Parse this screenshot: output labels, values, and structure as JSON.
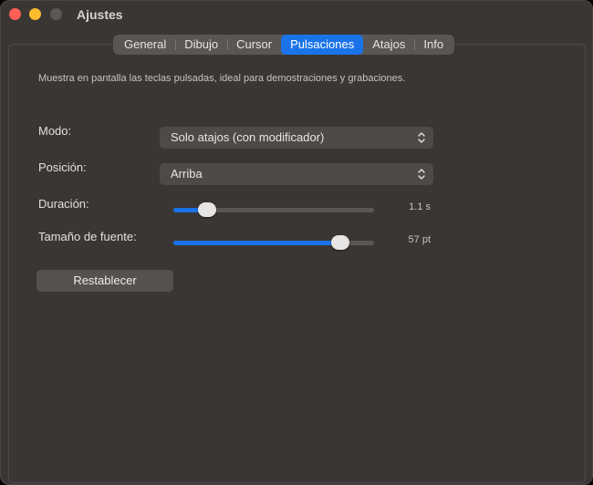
{
  "window": {
    "title": "Ajustes"
  },
  "tabs": [
    {
      "label": "General"
    },
    {
      "label": "Dibujo"
    },
    {
      "label": "Cursor"
    },
    {
      "label": "Pulsaciones",
      "active": true
    },
    {
      "label": "Atajos"
    },
    {
      "label": "Info"
    }
  ],
  "description": "Muestra en pantalla las teclas pulsadas, ideal para demostraciones y grabaciones.",
  "settings": {
    "mode": {
      "label": "Modo:",
      "value": "Solo atajos (con modificador)"
    },
    "position": {
      "label": "Posición:",
      "value": "Arriba"
    },
    "duration": {
      "label": "Duración:",
      "value_text": "1.1 s",
      "fraction": 0.17
    },
    "font_size": {
      "label": "Tamaño de fuente:",
      "value_text": "57 pt",
      "fraction": 0.83
    }
  },
  "reset_button": {
    "label": "Restablecer"
  },
  "colors": {
    "accent": "#1a73e8",
    "close": "#ff5f57",
    "minimize": "#febc2e",
    "zoom_disabled": "#5c5856",
    "background": "#3a3634"
  }
}
